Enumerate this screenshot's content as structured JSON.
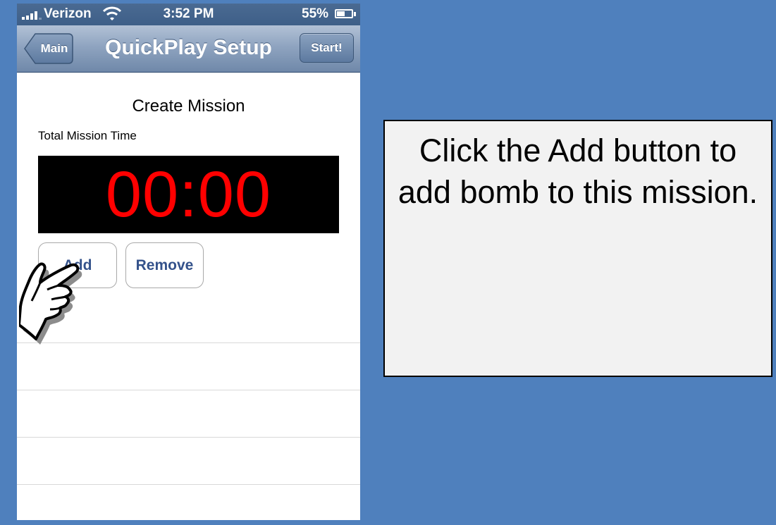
{
  "status_bar": {
    "carrier": "Verizon",
    "time": "3:52 PM",
    "battery_percent_label": "55%",
    "battery_level": 0.55,
    "signal_bars": 4,
    "icons": [
      "signal-bars-icon",
      "wifi-icon",
      "battery-icon"
    ]
  },
  "nav_bar": {
    "back_label": "Main",
    "title": "QuickPlay Setup",
    "start_label": "Start!"
  },
  "content": {
    "section_title": "Create Mission",
    "time_label": "Total Mission Time",
    "timer_value": "00:00",
    "add_label": "Add",
    "remove_label": "Remove",
    "empty_rows": 4
  },
  "overlay": {
    "pointer_icon": "pointing-hand-icon",
    "callout_text": "Click the Add button to add bomb to this mission."
  },
  "colors": {
    "background": "#4f80bd",
    "timer_digits": "#ff0000",
    "timer_background": "#000000",
    "button_text": "#34528b",
    "callout_background": "#f2f2f2"
  }
}
